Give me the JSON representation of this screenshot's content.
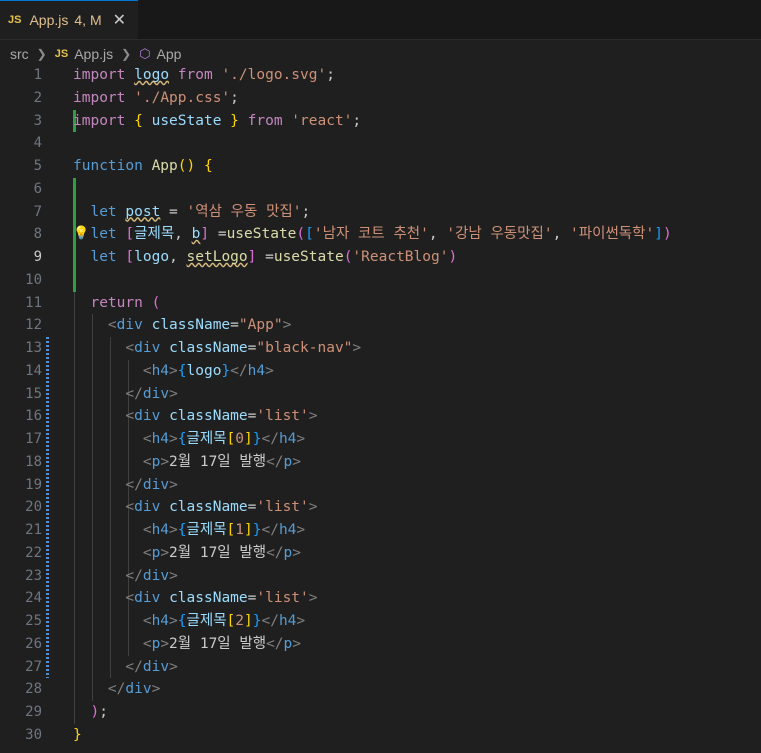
{
  "tab": {
    "js_badge": "JS",
    "filename": "App.js",
    "status": "4, M",
    "close": "✕"
  },
  "breadcrumb": {
    "folder": "src",
    "js_badge": "JS",
    "file": "App.js",
    "symbol": "App"
  },
  "lines": [
    {
      "n": "1",
      "tokens": [
        [
          "kw",
          "import"
        ],
        [
          "p",
          " "
        ],
        [
          "var squig",
          "logo"
        ],
        [
          "p",
          " "
        ],
        [
          "kw",
          "from"
        ],
        [
          "p",
          " "
        ],
        [
          "str",
          "'./logo.svg'"
        ],
        [
          "p",
          ";"
        ]
      ]
    },
    {
      "n": "2",
      "tokens": [
        [
          "kw",
          "import"
        ],
        [
          "p",
          " "
        ],
        [
          "str",
          "'./App.css'"
        ],
        [
          "p",
          ";"
        ]
      ]
    },
    {
      "n": "3",
      "tokens": [
        [
          "kw",
          "import"
        ],
        [
          "p",
          " "
        ],
        [
          "br1",
          "{"
        ],
        [
          "p",
          " "
        ],
        [
          "var",
          "useState"
        ],
        [
          "p",
          " "
        ],
        [
          "br1",
          "}"
        ],
        [
          "p",
          " "
        ],
        [
          "kw",
          "from"
        ],
        [
          "p",
          " "
        ],
        [
          "str",
          "'react'"
        ],
        [
          "p",
          ";"
        ]
      ]
    },
    {
      "n": "4",
      "tokens": []
    },
    {
      "n": "5",
      "tokens": [
        [
          "kw2",
          "function"
        ],
        [
          "p",
          " "
        ],
        [
          "fn",
          "App"
        ],
        [
          "br1",
          "()"
        ],
        [
          "p",
          " "
        ],
        [
          "br1",
          "{"
        ]
      ]
    },
    {
      "n": "6",
      "tokens": []
    },
    {
      "n": "7",
      "tokens": [
        [
          "p",
          "  "
        ],
        [
          "kw2",
          "let"
        ],
        [
          "p",
          " "
        ],
        [
          "var squig",
          "post"
        ],
        [
          "p",
          " = "
        ],
        [
          "str",
          "'역삼 우동 맛집'"
        ],
        [
          "p",
          ";"
        ]
      ]
    },
    {
      "n": "8",
      "tokens": [
        [
          "p",
          "  "
        ],
        [
          "kw2",
          "let"
        ],
        [
          "p",
          " "
        ],
        [
          "br2",
          "["
        ],
        [
          "var",
          "글제목"
        ],
        [
          "p",
          ", "
        ],
        [
          "var squig",
          "b"
        ],
        [
          "br2",
          "]"
        ],
        [
          "p",
          " ="
        ],
        [
          "fn",
          "useState"
        ],
        [
          "br2",
          "("
        ],
        [
          "br3",
          "["
        ],
        [
          "str",
          "'남자 코트 추천'"
        ],
        [
          "p",
          ", "
        ],
        [
          "str",
          "'강남 우동맛집'"
        ],
        [
          "p",
          ", "
        ],
        [
          "str",
          "'파이썬독학'"
        ],
        [
          "br3",
          "]"
        ],
        [
          "br2",
          ")"
        ]
      ]
    },
    {
      "n": "9",
      "tokens": [
        [
          "p",
          "  "
        ],
        [
          "kw2",
          "let"
        ],
        [
          "p",
          " "
        ],
        [
          "br2",
          "["
        ],
        [
          "var",
          "logo"
        ],
        [
          "p",
          ", "
        ],
        [
          "fn squig",
          "setLogo"
        ],
        [
          "br2",
          "]"
        ],
        [
          "p",
          " ="
        ],
        [
          "fn",
          "useState"
        ],
        [
          "br2",
          "("
        ],
        [
          "str",
          "'ReactBlog'"
        ],
        [
          "br2",
          ")"
        ]
      ]
    },
    {
      "n": "10",
      "tokens": []
    },
    {
      "n": "11",
      "tokens": [
        [
          "p",
          "  "
        ],
        [
          "kw",
          "return"
        ],
        [
          "p",
          " "
        ],
        [
          "br2",
          "("
        ]
      ]
    },
    {
      "n": "12",
      "tokens": [
        [
          "p",
          "    "
        ],
        [
          "gray",
          "<"
        ],
        [
          "tag",
          "div"
        ],
        [
          "p",
          " "
        ],
        [
          "attr",
          "className"
        ],
        [
          "p",
          "="
        ],
        [
          "str",
          "\"App\""
        ],
        [
          "gray",
          ">"
        ]
      ]
    },
    {
      "n": "13",
      "tokens": [
        [
          "p",
          "      "
        ],
        [
          "gray",
          "<"
        ],
        [
          "tag",
          "div"
        ],
        [
          "p",
          " "
        ],
        [
          "attr",
          "className"
        ],
        [
          "p",
          "="
        ],
        [
          "str",
          "\"black-nav\""
        ],
        [
          "gray",
          ">"
        ]
      ]
    },
    {
      "n": "14",
      "tokens": [
        [
          "p",
          "        "
        ],
        [
          "gray",
          "<"
        ],
        [
          "tag",
          "h4"
        ],
        [
          "gray",
          ">"
        ],
        [
          "br3",
          "{"
        ],
        [
          "var",
          "logo"
        ],
        [
          "br3",
          "}"
        ],
        [
          "gray",
          "</"
        ],
        [
          "tag",
          "h4"
        ],
        [
          "gray",
          ">"
        ]
      ]
    },
    {
      "n": "15",
      "tokens": [
        [
          "p",
          "      "
        ],
        [
          "gray",
          "</"
        ],
        [
          "tag",
          "div"
        ],
        [
          "gray",
          ">"
        ]
      ]
    },
    {
      "n": "16",
      "tokens": [
        [
          "p",
          "      "
        ],
        [
          "gray",
          "<"
        ],
        [
          "tag",
          "div"
        ],
        [
          "p",
          " "
        ],
        [
          "attr",
          "className"
        ],
        [
          "p",
          "="
        ],
        [
          "str",
          "'list'"
        ],
        [
          "gray",
          ">"
        ]
      ]
    },
    {
      "n": "17",
      "tokens": [
        [
          "p",
          "        "
        ],
        [
          "gray",
          "<"
        ],
        [
          "tag",
          "h4"
        ],
        [
          "gray",
          ">"
        ],
        [
          "br3",
          "{"
        ],
        [
          "var",
          "글제목"
        ],
        [
          "br1",
          "["
        ],
        [
          "str",
          "0"
        ],
        [
          "br1",
          "]"
        ],
        [
          "br3",
          "}"
        ],
        [
          "gray",
          "</"
        ],
        [
          "tag",
          "h4"
        ],
        [
          "gray",
          ">"
        ]
      ]
    },
    {
      "n": "18",
      "tokens": [
        [
          "p",
          "        "
        ],
        [
          "gray",
          "<"
        ],
        [
          "tag",
          "p"
        ],
        [
          "gray",
          ">"
        ],
        [
          "p",
          "2월 17일 발행"
        ],
        [
          "gray",
          "</"
        ],
        [
          "tag",
          "p"
        ],
        [
          "gray",
          ">"
        ]
      ]
    },
    {
      "n": "19",
      "tokens": [
        [
          "p",
          "      "
        ],
        [
          "gray",
          "</"
        ],
        [
          "tag",
          "div"
        ],
        [
          "gray",
          ">"
        ]
      ]
    },
    {
      "n": "20",
      "tokens": [
        [
          "p",
          "      "
        ],
        [
          "gray",
          "<"
        ],
        [
          "tag",
          "div"
        ],
        [
          "p",
          " "
        ],
        [
          "attr",
          "className"
        ],
        [
          "p",
          "="
        ],
        [
          "str",
          "'list'"
        ],
        [
          "gray",
          ">"
        ]
      ]
    },
    {
      "n": "21",
      "tokens": [
        [
          "p",
          "        "
        ],
        [
          "gray",
          "<"
        ],
        [
          "tag",
          "h4"
        ],
        [
          "gray",
          ">"
        ],
        [
          "br3",
          "{"
        ],
        [
          "var",
          "글제목"
        ],
        [
          "br1",
          "["
        ],
        [
          "str",
          "1"
        ],
        [
          "br1",
          "]"
        ],
        [
          "br3",
          "}"
        ],
        [
          "gray",
          "</"
        ],
        [
          "tag",
          "h4"
        ],
        [
          "gray",
          ">"
        ]
      ]
    },
    {
      "n": "22",
      "tokens": [
        [
          "p",
          "        "
        ],
        [
          "gray",
          "<"
        ],
        [
          "tag",
          "p"
        ],
        [
          "gray",
          ">"
        ],
        [
          "p",
          "2월 17일 발행"
        ],
        [
          "gray",
          "</"
        ],
        [
          "tag",
          "p"
        ],
        [
          "gray",
          ">"
        ]
      ]
    },
    {
      "n": "23",
      "tokens": [
        [
          "p",
          "      "
        ],
        [
          "gray",
          "</"
        ],
        [
          "tag",
          "div"
        ],
        [
          "gray",
          ">"
        ]
      ]
    },
    {
      "n": "24",
      "tokens": [
        [
          "p",
          "      "
        ],
        [
          "gray",
          "<"
        ],
        [
          "tag",
          "div"
        ],
        [
          "p",
          " "
        ],
        [
          "attr",
          "className"
        ],
        [
          "p",
          "="
        ],
        [
          "str",
          "'list'"
        ],
        [
          "gray",
          ">"
        ]
      ]
    },
    {
      "n": "25",
      "tokens": [
        [
          "p",
          "        "
        ],
        [
          "gray",
          "<"
        ],
        [
          "tag",
          "h4"
        ],
        [
          "gray",
          ">"
        ],
        [
          "br3",
          "{"
        ],
        [
          "var",
          "글제목"
        ],
        [
          "br1",
          "["
        ],
        [
          "str",
          "2"
        ],
        [
          "br1",
          "]"
        ],
        [
          "br3",
          "}"
        ],
        [
          "gray",
          "</"
        ],
        [
          "tag",
          "h4"
        ],
        [
          "gray",
          ">"
        ]
      ]
    },
    {
      "n": "26",
      "tokens": [
        [
          "p",
          "        "
        ],
        [
          "gray",
          "<"
        ],
        [
          "tag",
          "p"
        ],
        [
          "gray",
          ">"
        ],
        [
          "p",
          "2월 17일 발행"
        ],
        [
          "gray",
          "</"
        ],
        [
          "tag",
          "p"
        ],
        [
          "gray",
          ">"
        ]
      ]
    },
    {
      "n": "27",
      "tokens": [
        [
          "p",
          "      "
        ],
        [
          "gray",
          "</"
        ],
        [
          "tag",
          "div"
        ],
        [
          "gray",
          ">"
        ]
      ]
    },
    {
      "n": "28",
      "tokens": [
        [
          "p",
          "    "
        ],
        [
          "gray",
          "</"
        ],
        [
          "tag",
          "div"
        ],
        [
          "gray",
          ">"
        ]
      ]
    },
    {
      "n": "29",
      "tokens": [
        [
          "p",
          "  "
        ],
        [
          "br2",
          ")"
        ],
        [
          "p",
          ";"
        ]
      ]
    },
    {
      "n": "30",
      "tokens": [
        [
          "br1",
          "}"
        ]
      ]
    }
  ],
  "active_line": "9",
  "lightbulb_line": "8",
  "icons": {
    "lightbulb": "lightbulb-icon",
    "symbol": "symbol-class-icon",
    "chevron": "chevron-right-icon"
  }
}
